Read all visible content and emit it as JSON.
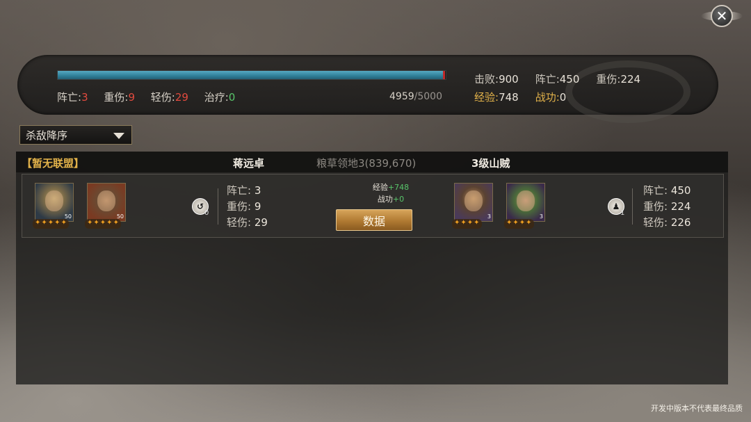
{
  "summary": {
    "progress_fraction": 0.992,
    "losses": {
      "killed_label": "阵亡:",
      "killed": "3",
      "heavy_label": "重伤:",
      "heavy": "9",
      "light_label": "轻伤:",
      "light": "29",
      "heal_label": "治疗:",
      "heal": "0"
    },
    "troops_current": "4959",
    "troops_max": "/5000",
    "stats": {
      "defeat_label": "击败:",
      "defeat": "900",
      "killed_label": "阵亡:",
      "killed": "450",
      "heavy_label": "重伤:",
      "heavy": "224",
      "exp_label": "经验:",
      "exp": "748",
      "merit_label": "战功:",
      "merit": "0"
    }
  },
  "sort_select": {
    "value": "杀敌降序"
  },
  "list_header": {
    "alliance": "【暂无联盟】",
    "player": "蒋远卓",
    "location": "粮草领地3(839,670)",
    "enemy": "3级山贼"
  },
  "battle": {
    "left_heroes": [
      {
        "level": "50",
        "stars": 5
      },
      {
        "level": "50",
        "stars": 5
      }
    ],
    "left_army_count": "0",
    "left_losses": {
      "killed_label": "阵亡:",
      "killed": "3",
      "heavy_label": "重伤:",
      "heavy": "9",
      "light_label": "轻伤:",
      "light": "29"
    },
    "rewards": {
      "exp_label": "经验",
      "exp": "+748",
      "merit_label": "战功",
      "merit": "+0"
    },
    "data_button": "数据",
    "right_heroes": [
      {
        "level": "3",
        "stars": 4
      },
      {
        "level": "3",
        "stars": 4
      }
    ],
    "right_army_count": "1",
    "right_losses": {
      "killed_label": "阵亡:",
      "killed": "450",
      "heavy_label": "重伤:",
      "heavy": "224",
      "light_label": "轻伤:",
      "light": "226"
    }
  },
  "watermark": "开发中版本不代表最终品质",
  "icons": {
    "close": "close-icon",
    "dropdown": "triangle-down-icon",
    "army": "army-icon"
  },
  "colors": {
    "accent_gold": "#e2b24a",
    "loss_red": "#e24a3e",
    "heal_green": "#58c56a",
    "bar_blue": "#3a8aa6"
  }
}
